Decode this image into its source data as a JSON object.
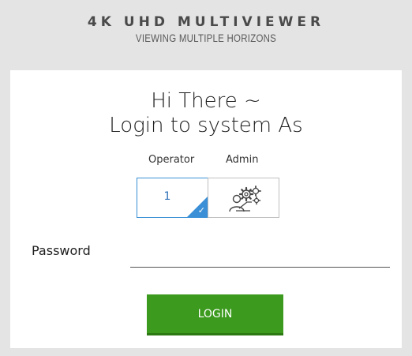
{
  "header": {
    "title": "4K UHD MULTIVIEWER",
    "subtitle": "VIEWING MULTIPLE HORIZONS"
  },
  "login": {
    "greeting_line1": "Hi There ~",
    "greeting_line2": "Login to system As",
    "roles": {
      "operator": {
        "label": "Operator",
        "value": "1",
        "selected": true,
        "icon": "checkmark-icon"
      },
      "admin": {
        "label": "Admin",
        "icon": "admin-gears-icon"
      }
    },
    "password": {
      "label": "Password",
      "value": "",
      "placeholder": ""
    },
    "login_button": "LOGIN"
  },
  "colors": {
    "accent_blue": "#3a8fd6",
    "login_green": "#3c9a1e",
    "background_gray": "#e4e4e4"
  }
}
